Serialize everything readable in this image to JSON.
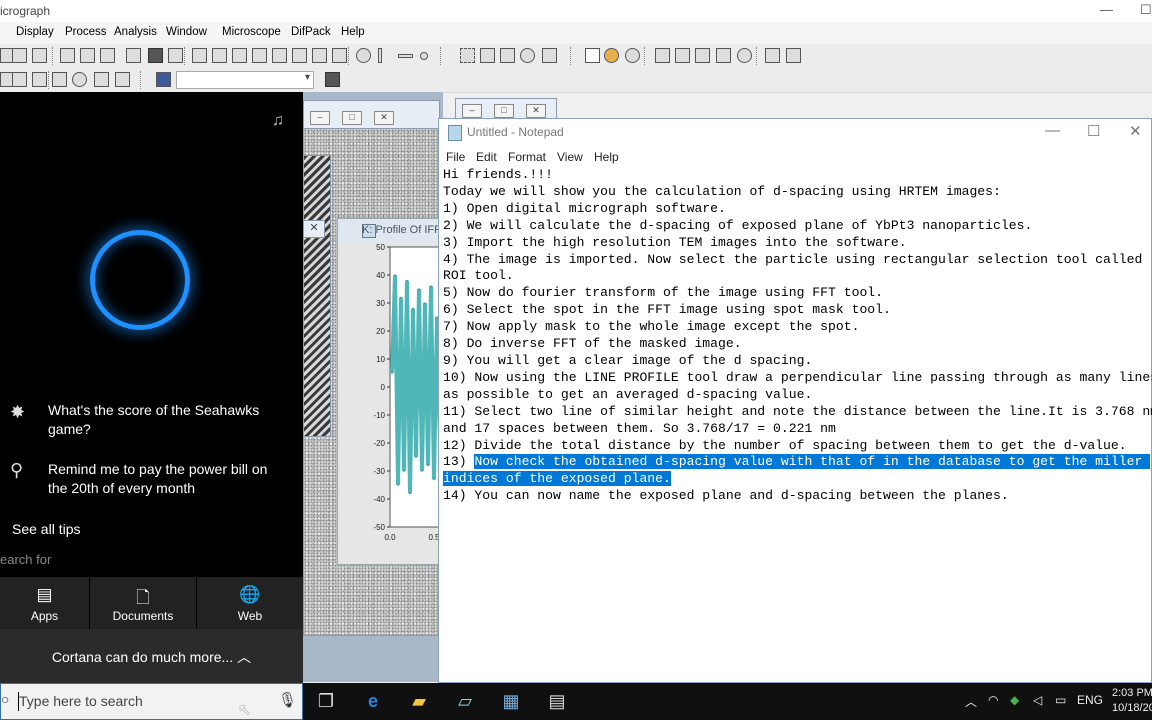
{
  "dm": {
    "title": "icrograph",
    "menu": [
      "Display",
      "Process",
      "Analysis",
      "Window",
      "Microscope",
      "DifPack",
      "Help"
    ],
    "window_controls": {
      "minimize": "—",
      "maximize": "☐"
    }
  },
  "profile_window": {
    "title": "K: Profile Of IFF",
    "chart_data": {
      "type": "line",
      "title": "",
      "xlabel": "",
      "ylabel": "",
      "ylim": [
        -50,
        50
      ],
      "y_ticks": [
        "50",
        "40",
        "30",
        "20",
        "10",
        "0",
        "-10",
        "-20",
        "-30",
        "-40",
        "-50"
      ],
      "x_ticks": [
        "0.0",
        "0.5"
      ],
      "series": [
        {
          "values": [
            5,
            40,
            -35,
            32,
            -30,
            38,
            -38,
            28,
            -25,
            35,
            -30,
            30,
            -28,
            36,
            -33,
            25,
            -20
          ]
        }
      ]
    }
  },
  "cortana": {
    "tip1": "What's the score of the Seahawks game?",
    "tip2": "Remind me to pay the power bill on the 20th of every month",
    "see_all": "See all tips",
    "search_for": "earch for",
    "tabs": [
      {
        "label": "Apps",
        "icon": "▤"
      },
      {
        "label": "Documents",
        "icon": "🗋"
      },
      {
        "label": "Web",
        "icon": "🌐"
      }
    ],
    "more": "Cortana can do much more...",
    "more_icon": "︿"
  },
  "taskbar": {
    "search_placeholder": "Type here to search",
    "lang": "ENG",
    "time": "2:03 PM",
    "date": "10/18/20"
  },
  "notepad": {
    "title": "Untitled - Notepad",
    "menu": [
      "File",
      "Edit",
      "Format",
      "View",
      "Help"
    ],
    "controls": {
      "minimize": "—",
      "maximize": "☐",
      "close": "✕"
    },
    "lines": [
      "Hi friends.!!!",
      "Today we will show you the calculation of d-spacing using HRTEM images:",
      "1) Open digital micrograph software.",
      "2) We will calculate the d-spacing of exposed plane of YbPt3 nanoparticles.",
      "3) Import the high resolution TEM images into the software.",
      "4) The image is imported. Now select the particle using rectangular selection tool called",
      "ROI tool.",
      "5) Now do fourier transform of the image using FFT tool.",
      "6) Select the spot in the FFT image using spot mask tool.",
      "7) Now apply mask to the whole image except the spot.",
      "8) Do inverse FFT of the masked image.",
      "9) You will get a clear image of the d spacing.",
      "10) Now using the LINE PROFILE tool draw a perpendicular line passing through as many lines",
      "as possible to get an averaged d-spacing value.",
      "11) Select two line of similar height and note the distance between the line.It is 3.768 nm",
      "and 17 spaces between them. So 3.768/17 = 0.221 nm",
      "12) Divide the total distance by the number of spacing between them to get the d-value."
    ],
    "line13_prefix": "13) ",
    "line13_selected": "Now check the obtained d-spacing value with that of in the database to get the miller ",
    "line13b_selected": "indices of the exposed plane.",
    "line14": "14) You can now name the exposed plane and d-spacing between the planes."
  }
}
